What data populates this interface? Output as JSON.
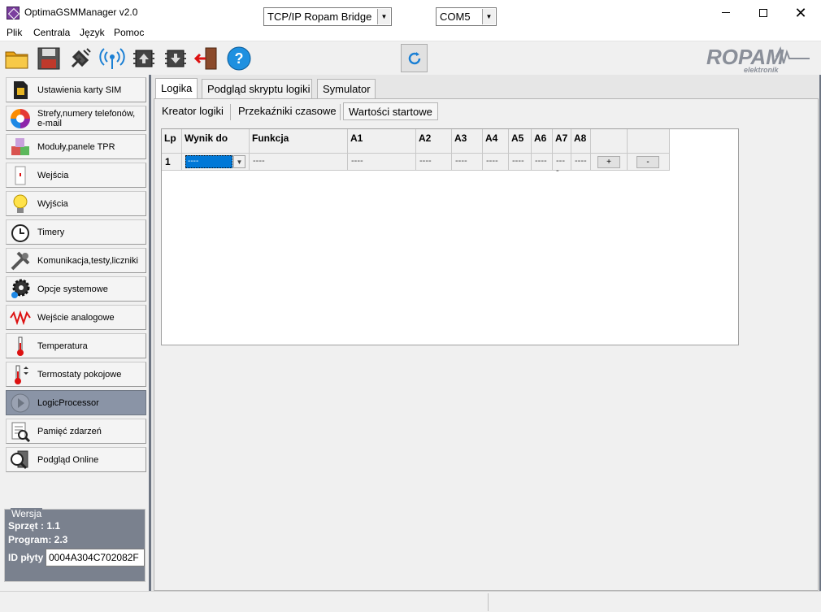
{
  "window": {
    "title": "OptimaGSMManager v2.0"
  },
  "menu": [
    {
      "label": "Plik"
    },
    {
      "label": "Centrala"
    },
    {
      "label": "Język"
    },
    {
      "label": "Pomoc"
    }
  ],
  "toolbar": {
    "connection_type": "TCP/IP Ropam Bridge",
    "port": "COM5",
    "logo_text": "ROPAM",
    "logo_subtext": "elektronik"
  },
  "sidebar": {
    "items": [
      {
        "label": "Ustawienia karty SIM",
        "icon": "sim-card-icon"
      },
      {
        "label": "Strefy,numery telefonów, e-mail",
        "icon": "zones-icon"
      },
      {
        "label": "Moduły,panele TPR",
        "icon": "modules-icon"
      },
      {
        "label": "Wejścia",
        "icon": "inputs-icon"
      },
      {
        "label": "Wyjścia",
        "icon": "bulb-icon"
      },
      {
        "label": "Timery",
        "icon": "clock-icon"
      },
      {
        "label": "Komunikacja,testy,liczniki",
        "icon": "tools-icon"
      },
      {
        "label": "Opcje systemowe",
        "icon": "gear-icon"
      },
      {
        "label": "Wejście analogowe",
        "icon": "wave-icon"
      },
      {
        "label": "Temperatura",
        "icon": "thermometer-icon"
      },
      {
        "label": "Termostaty pokojowe",
        "icon": "thermostat-icon"
      },
      {
        "label": "LogicProcessor",
        "icon": "play-icon"
      },
      {
        "label": "Pamięć zdarzeń",
        "icon": "event-log-icon"
      },
      {
        "label": "Podgląd Online",
        "icon": "online-icon"
      }
    ],
    "active_index": 11
  },
  "version": {
    "legend": "Wersja",
    "hardware": "Sprzęt : 1.1",
    "program": "Program: 2.3",
    "board_id_label": "ID płyty",
    "board_id": "0004A304C702082F"
  },
  "main": {
    "tabs": [
      {
        "label": "Logika"
      },
      {
        "label": "Podgląd skryptu logiki"
      },
      {
        "label": "Symulator"
      }
    ],
    "subtabs": [
      {
        "label": "Kreator logiki"
      },
      {
        "label": "Przekaźniki czasowe"
      },
      {
        "label": "Wartości startowe"
      }
    ],
    "grid": {
      "headers": [
        "Lp",
        "Wynik do",
        "Funkcja",
        "A1",
        "A2",
        "A3",
        "A4",
        "A5",
        "A6",
        "A7",
        "A8",
        "",
        ""
      ],
      "row": {
        "lp": "1",
        "wynik": "----",
        "funkcja": "----",
        "a": [
          "----",
          "----",
          "----",
          "----",
          "----",
          "----",
          "----",
          "----"
        ],
        "add": "+",
        "remove": "-"
      }
    }
  },
  "status": {
    "left": "",
    "right": ""
  }
}
